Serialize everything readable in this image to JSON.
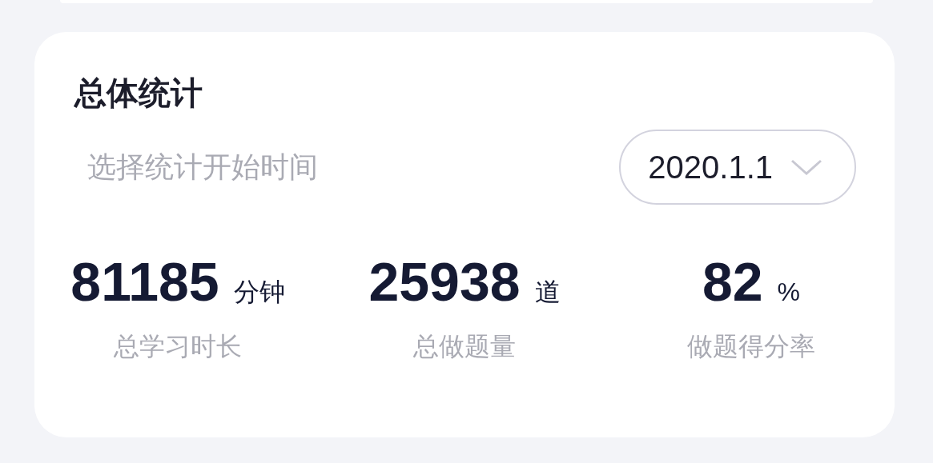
{
  "title": "总体统计",
  "date_filter": {
    "label": "选择统计开始时间",
    "value": "2020.1.1"
  },
  "stats": [
    {
      "value": "81185",
      "unit": "分钟",
      "label": "总学习时长"
    },
    {
      "value": "25938",
      "unit": "道",
      "label": "总做题量"
    },
    {
      "value": "82",
      "unit": "%",
      "label": "做题得分率"
    }
  ]
}
